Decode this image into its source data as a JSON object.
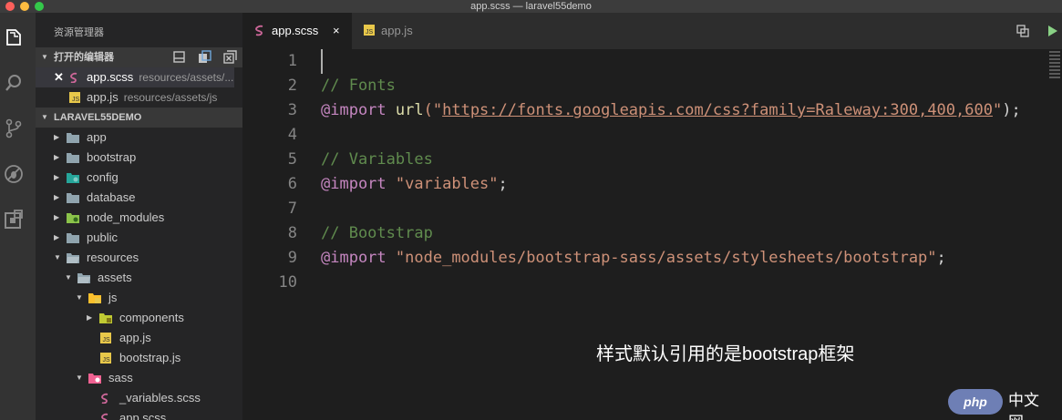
{
  "window": {
    "title": "app.scss — laravel55demo"
  },
  "colors": {
    "accent": "#007acc",
    "sass": "#cd6799",
    "js": "#e8c84a",
    "folder": "#90a4ae"
  },
  "activity_bar": [
    {
      "icon": "explorer-icon",
      "active": true
    },
    {
      "icon": "search-icon",
      "active": false
    },
    {
      "icon": "source-control-icon",
      "active": false
    },
    {
      "icon": "debug-icon",
      "active": false
    },
    {
      "icon": "extensions-icon",
      "active": false
    }
  ],
  "sidebar": {
    "title": "资源管理器",
    "open_editors": {
      "label": "打开的编辑器",
      "items": [
        {
          "name": "app.scss",
          "path": "resources/assets/...",
          "icon": "sass-icon"
        },
        {
          "name": "app.js",
          "path": "resources/assets/js",
          "icon": "js-icon"
        }
      ]
    },
    "project": {
      "label": "LARAVEL55DEMO",
      "items": [
        {
          "name": "app",
          "icon": "folder-icon",
          "arrow": "▶"
        },
        {
          "name": "bootstrap",
          "icon": "folder-icon",
          "arrow": "▶"
        },
        {
          "name": "config",
          "icon": "config-folder-icon",
          "arrow": "▶"
        },
        {
          "name": "database",
          "icon": "folder-icon",
          "arrow": "▶"
        },
        {
          "name": "node_modules",
          "icon": "node-folder-icon",
          "arrow": "▶"
        },
        {
          "name": "public",
          "icon": "folder-icon",
          "arrow": "▶"
        },
        {
          "name": "resources",
          "icon": "folder-open-icon",
          "arrow": "▼"
        },
        {
          "name": "assets",
          "icon": "folder-open-icon",
          "arrow": "▼"
        },
        {
          "name": "js",
          "icon": "js-folder-icon",
          "arrow": "▼"
        },
        {
          "name": "components",
          "icon": "components-folder-icon",
          "arrow": "▶"
        },
        {
          "name": "app.js",
          "icon": "js-icon",
          "arrow": ""
        },
        {
          "name": "bootstrap.js",
          "icon": "js-icon",
          "arrow": ""
        },
        {
          "name": "sass",
          "icon": "sass-folder-icon",
          "arrow": "▼"
        },
        {
          "name": "_variables.scss",
          "icon": "sass-icon",
          "arrow": ""
        },
        {
          "name": "app.scss",
          "icon": "sass-icon",
          "arrow": ""
        }
      ]
    }
  },
  "tabs": [
    {
      "label": "app.scss",
      "icon": "sass-icon",
      "active": true,
      "close": "×"
    },
    {
      "label": "app.js",
      "icon": "js-icon",
      "active": false,
      "close": ""
    }
  ],
  "editor": {
    "line_numbers": [
      "1",
      "2",
      "3",
      "4",
      "5",
      "6",
      "7",
      "8",
      "9",
      "10"
    ],
    "lines": [
      [],
      [
        {
          "t": "// Fonts",
          "c": "comment"
        }
      ],
      [
        {
          "t": "@import",
          "c": "key"
        },
        {
          "t": " ",
          "c": "plain"
        },
        {
          "t": "url",
          "c": "fn"
        },
        {
          "t": "(\"",
          "c": "str"
        },
        {
          "t": "https://fonts.googleapis.com/css?family=Raleway:300,400,600",
          "c": "url"
        },
        {
          "t": "\"",
          "c": "str"
        },
        {
          "t": ");",
          "c": "plain"
        }
      ],
      [],
      [
        {
          "t": "// Variables",
          "c": "comment"
        }
      ],
      [
        {
          "t": "@import",
          "c": "key"
        },
        {
          "t": " ",
          "c": "plain"
        },
        {
          "t": "\"variables\"",
          "c": "str"
        },
        {
          "t": ";",
          "c": "plain"
        }
      ],
      [],
      [
        {
          "t": "// Bootstrap",
          "c": "comment"
        }
      ],
      [
        {
          "t": "@import",
          "c": "key"
        },
        {
          "t": " ",
          "c": "plain"
        },
        {
          "t": "\"node_modules/bootstrap-sass/assets/stylesheets/bootstrap\"",
          "c": "str"
        },
        {
          "t": ";",
          "c": "plain"
        }
      ],
      []
    ]
  },
  "annotation": "样式默认引用的是bootstrap框架",
  "watermark": {
    "logo": "php",
    "text": "中文网"
  }
}
